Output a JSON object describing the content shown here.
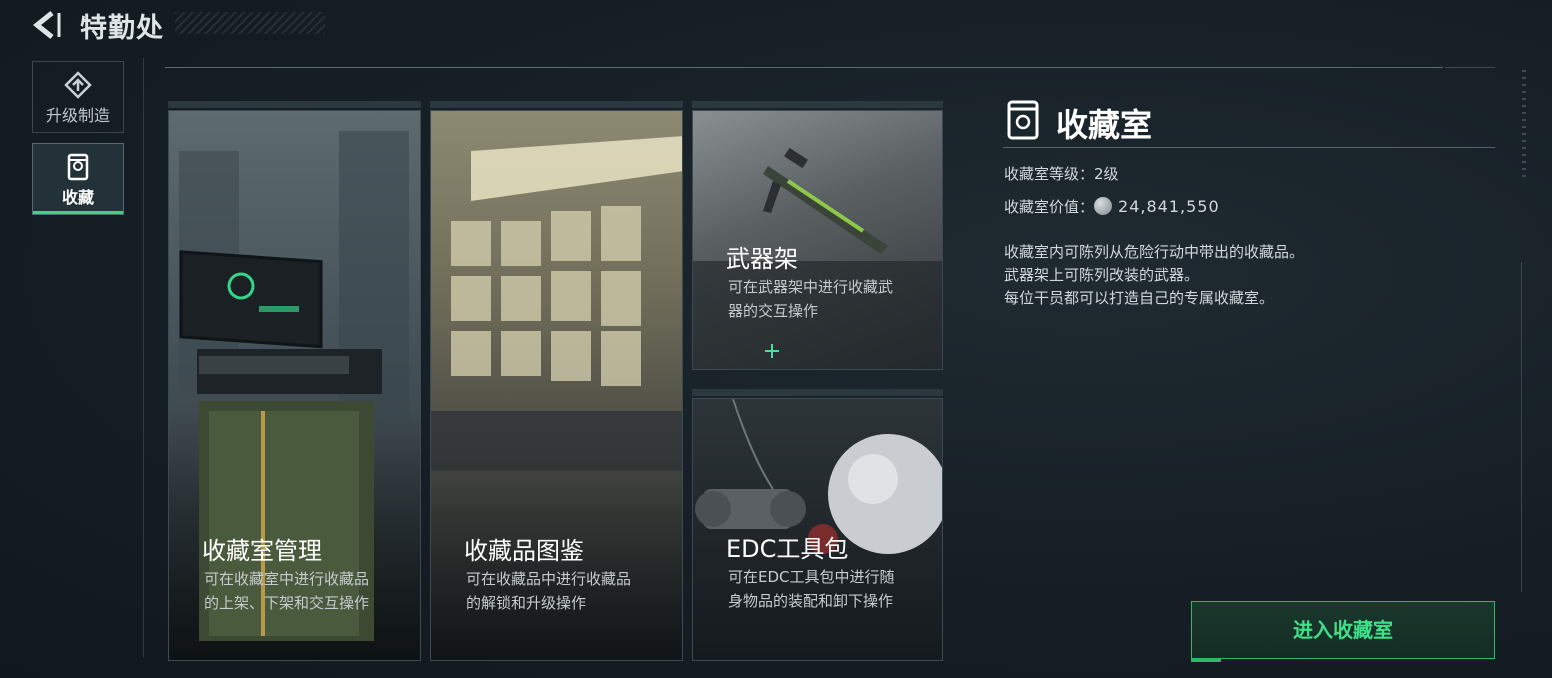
{
  "header": {
    "title": "特勤处",
    "back_icon": "back-arrow-icon"
  },
  "sidebar": {
    "items": [
      {
        "label": "升级制造",
        "icon": "upgrade-icon",
        "active": false
      },
      {
        "label": "收藏",
        "icon": "collection-icon",
        "active": true
      }
    ]
  },
  "cards": [
    {
      "title": "收藏室管理",
      "desc_line1": "可在收藏室中进行收藏品",
      "desc_line2": "的上架、下架和交互操作"
    },
    {
      "title": "收藏品图鉴",
      "desc_line1": "可在收藏品中进行收藏品",
      "desc_line2": "的解锁和升级操作"
    },
    {
      "title": "武器架",
      "desc_line1": "可在武器架中进行收藏武",
      "desc_line2": "器的交互操作"
    },
    {
      "title": "EDC工具包",
      "desc_line1": "可在EDC工具包中进行随",
      "desc_line2": "身物品的装配和卸下操作"
    }
  ],
  "info": {
    "title": "收藏室",
    "level_label": "收藏室等级：",
    "level_value": "2级",
    "value_label": "收藏室价值：",
    "value_amount": "24,841,550",
    "desc_line1": "收藏室内可陈列从危险行动中带出的收藏品。",
    "desc_line2": "武器架上可陈列改装的武器。",
    "desc_line3": "每位干员都可以打造自己的专属收藏室。"
  },
  "enter_button": {
    "label": "进入收藏室"
  },
  "colors": {
    "accent": "#39d67a",
    "background": "#172027"
  }
}
